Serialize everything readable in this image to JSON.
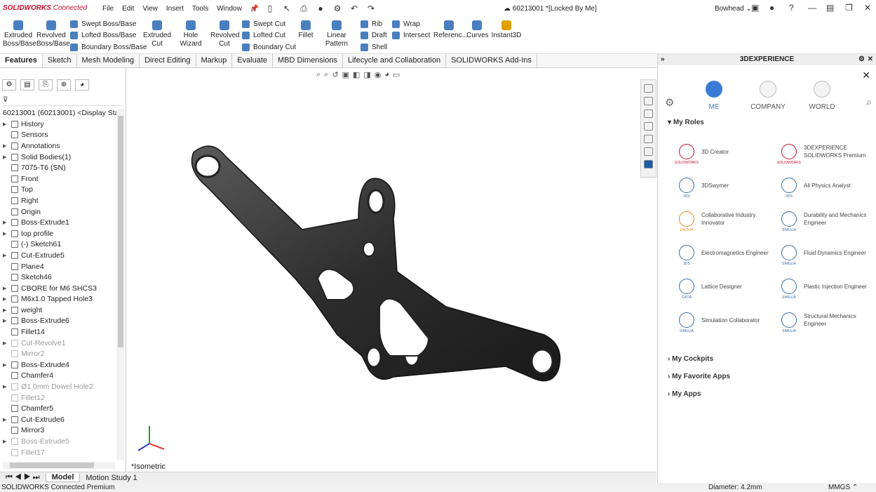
{
  "app": {
    "brand": "SOLIDWORKS",
    "brand_suffix": "Connected",
    "doc_title": "60213001 *[Locked By Me]",
    "user": "Bowhead"
  },
  "menus": [
    "File",
    "Edit",
    "View",
    "Insert",
    "Tools",
    "Window"
  ],
  "commands": {
    "extruded_boss": "Extruded Boss/Base",
    "revolved_boss": "Revolved Boss/Base",
    "swept_boss": "Swept Boss/Base",
    "lofted_boss": "Lofted Boss/Base",
    "boundary_boss": "Boundary Boss/Base",
    "extruded_cut": "Extruded Cut",
    "hole_wizard": "Hole Wizard",
    "revolved_cut": "Revolved Cut",
    "swept_cut": "Swept Cut",
    "lofted_cut": "Lofted Cut",
    "boundary_cut": "Boundary Cut",
    "fillet": "Fillet",
    "linear_pattern": "Linear Pattern",
    "rib": "Rib",
    "draft": "Draft",
    "shell": "Shell",
    "wrap": "Wrap",
    "intersect": "Intersect",
    "reference": "Referenc...",
    "curves": "Curves",
    "instant3d": "Instant3D"
  },
  "tabs": [
    "Features",
    "Sketch",
    "Mesh Modeling",
    "Direct Editing",
    "Markup",
    "Evaluate",
    "MBD Dimensions",
    "Lifecycle and Collaboration",
    "SOLIDWORKS Add-Ins"
  ],
  "tree": {
    "root": "60213001 (60213001) <Display Sta",
    "items": [
      {
        "label": "History",
        "exp": true,
        "gray": false
      },
      {
        "label": "Sensors",
        "exp": false,
        "gray": false
      },
      {
        "label": "Annotations",
        "exp": true,
        "gray": false
      },
      {
        "label": "Solid Bodies(1)",
        "exp": true,
        "gray": false
      },
      {
        "label": "7075-T6 (SN)",
        "exp": false,
        "gray": false
      },
      {
        "label": "Front",
        "exp": false,
        "gray": false
      },
      {
        "label": "Top",
        "exp": false,
        "gray": false
      },
      {
        "label": "Right",
        "exp": false,
        "gray": false
      },
      {
        "label": "Origin",
        "exp": false,
        "gray": false
      },
      {
        "label": "Boss-Extrude1",
        "exp": true,
        "gray": false
      },
      {
        "label": "top profile",
        "exp": true,
        "gray": false
      },
      {
        "label": "(-) Sketch61",
        "exp": false,
        "gray": false
      },
      {
        "label": "Cut-Extrude5",
        "exp": true,
        "gray": false
      },
      {
        "label": "Plane4",
        "exp": false,
        "gray": false
      },
      {
        "label": "Sketch46",
        "exp": false,
        "gray": false
      },
      {
        "label": "CBORE for M6 SHCS3",
        "exp": true,
        "gray": false
      },
      {
        "label": "M6x1.0 Tapped Hole3",
        "exp": true,
        "gray": false
      },
      {
        "label": "weight",
        "exp": true,
        "gray": false
      },
      {
        "label": "Boss-Extrude6",
        "exp": true,
        "gray": false
      },
      {
        "label": "Fillet14",
        "exp": false,
        "gray": false
      },
      {
        "label": "Cut-Revolve1",
        "exp": true,
        "gray": true
      },
      {
        "label": "Mirror2",
        "exp": false,
        "gray": true
      },
      {
        "label": "Boss-Extrude4",
        "exp": true,
        "gray": false
      },
      {
        "label": "Chamfer4",
        "exp": false,
        "gray": false
      },
      {
        "label": "Ø1.0mm Dowel Hole2",
        "exp": true,
        "gray": true
      },
      {
        "label": "Fillet12",
        "exp": false,
        "gray": true
      },
      {
        "label": "Chamfer5",
        "exp": false,
        "gray": false
      },
      {
        "label": "Cut-Extrude6",
        "exp": true,
        "gray": false
      },
      {
        "label": "Mirror3",
        "exp": false,
        "gray": false
      },
      {
        "label": "Boss-Extrude5",
        "exp": true,
        "gray": true
      },
      {
        "label": "Fillet17",
        "exp": false,
        "gray": true
      }
    ]
  },
  "viewport": {
    "view_label": "*Isometric"
  },
  "bottom_tabs": [
    "Model",
    "Motion Study 1"
  ],
  "status": {
    "left": "SOLIDWORKS Connected Premium",
    "measure": "Diameter: 4.2mm",
    "units": "MMGS"
  },
  "panel": {
    "title": "3DEXPERIENCE",
    "nav": [
      "ME",
      "COMPANY",
      "WORLD"
    ],
    "my_roles": "My Roles",
    "roles": [
      {
        "name": "3D Creator",
        "brand": "SOLIDWORKS",
        "color": "#c8102e"
      },
      {
        "name": "3DEXPERIENCE SOLIDWORKS Premium",
        "brand": "SOLIDWORKS",
        "color": "#c8102e"
      },
      {
        "name": "3DSwymer",
        "brand": "3DS",
        "color": "#3a6ea5"
      },
      {
        "name": "All Physics Analyst",
        "brand": "3DS",
        "color": "#3a6ea5"
      },
      {
        "name": "Collaborative Industry Innovator",
        "brand": "ENOVIA",
        "color": "#e08a1e"
      },
      {
        "name": "Durability and Mechanics Engineer",
        "brand": "SIMULIA",
        "color": "#3a6ea5"
      },
      {
        "name": "Electromagnetics Engineer",
        "brand": "3DS",
        "color": "#3a6ea5"
      },
      {
        "name": "Fluid Dynamics Engineer",
        "brand": "SIMULIA",
        "color": "#3a6ea5"
      },
      {
        "name": "Lattice Designer",
        "brand": "CATIA",
        "color": "#3a6ea5"
      },
      {
        "name": "Plastic Injection Engineer",
        "brand": "SIMULIA",
        "color": "#3a6ea5"
      },
      {
        "name": "Simulation Collaborator",
        "brand": "SIMULIA",
        "color": "#3a6ea5"
      },
      {
        "name": "Structural Mechanics Engineer",
        "brand": "SIMULIA",
        "color": "#3a6ea5"
      }
    ],
    "sections": [
      "My Cockpits",
      "My Favorite Apps",
      "My Apps"
    ]
  }
}
